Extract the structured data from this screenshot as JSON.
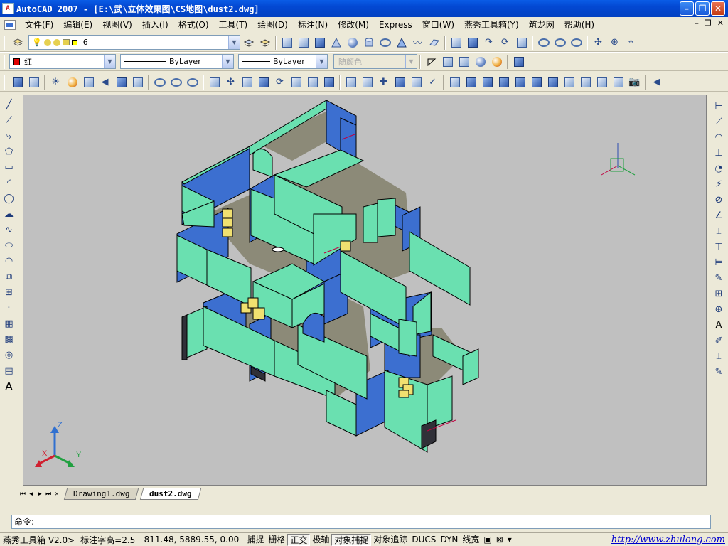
{
  "window": {
    "app_icon": "A",
    "title": "AutoCAD 2007 - [E:\\武\\立体效果图\\CS地图\\dust2.dwg]",
    "minimize": "–",
    "maximize": "❐",
    "close": "✕"
  },
  "menu": {
    "items": [
      "文件(F)",
      "编辑(E)",
      "视图(V)",
      "插入(I)",
      "格式(O)",
      "工具(T)",
      "绘图(D)",
      "标注(N)",
      "修改(M)",
      "Express",
      "窗口(W)",
      "燕秀工具箱(Y)",
      "筑龙网",
      "帮助(H)"
    ],
    "doc_minimize": "–",
    "doc_restore": "❐",
    "doc_close": "✕"
  },
  "layer": {
    "current": "6"
  },
  "properties": {
    "color": "红",
    "linetype": "ByLayer",
    "lineweight": "ByLayer",
    "plotstyle": "随颜色"
  },
  "colors": {
    "titlebar": "#0348d2",
    "viewport_bg": "#c0c0c0",
    "wall_face_blue": "#3c6fd0",
    "wall_face_teal": "#6ae0b0",
    "floor": "#8c8a78",
    "crate": "#f0e070",
    "red_swatch": "#e00000"
  },
  "viewport": {
    "ucs_x": "X",
    "ucs_y": "Y",
    "ucs_z": "Z"
  },
  "tabs": {
    "nav_first": "⏮",
    "nav_prev": "◀",
    "nav_next": "▶",
    "nav_last": "⏭",
    "close": "✕",
    "items": [
      "Drawing1.dwg",
      "dust2.dwg"
    ],
    "active": "dust2.dwg"
  },
  "command": {
    "prompt": "命令:"
  },
  "status": {
    "tool_label": "燕秀工具箱 V2.0>",
    "text_height": "标注字高=2.5",
    "coords": "-811.48,  5889.55, 0.00",
    "toggles": [
      {
        "label": "捕捉",
        "on": false
      },
      {
        "label": "栅格",
        "on": false
      },
      {
        "label": "正交",
        "on": true
      },
      {
        "label": "极轴",
        "on": false
      },
      {
        "label": "对象捕捉",
        "on": true
      },
      {
        "label": "对象追踪",
        "on": false
      },
      {
        "label": "DUCS",
        "on": false
      },
      {
        "label": "DYN",
        "on": false
      },
      {
        "label": "线宽",
        "on": false
      }
    ],
    "link": "http://www.zhulong.com"
  }
}
